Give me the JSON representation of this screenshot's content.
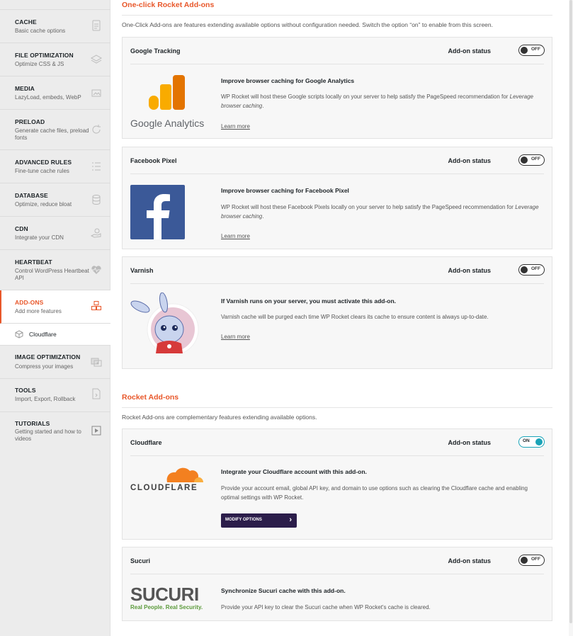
{
  "sidebar": {
    "items": [
      {
        "title": "CACHE",
        "sub": "Basic cache options",
        "icon": "document-icon"
      },
      {
        "title": "FILE OPTIMIZATION",
        "sub": "Optimize CSS & JS",
        "icon": "layers-icon"
      },
      {
        "title": "MEDIA",
        "sub": "LazyLoad, embeds, WebP",
        "icon": "image-icon"
      },
      {
        "title": "PRELOAD",
        "sub": "Generate cache files, preload fonts",
        "icon": "refresh-icon"
      },
      {
        "title": "ADVANCED RULES",
        "sub": "Fine-tune cache rules",
        "icon": "list-icon"
      },
      {
        "title": "DATABASE",
        "sub": "Optimize, reduce bloat",
        "icon": "database-icon"
      },
      {
        "title": "CDN",
        "sub": "Integrate your CDN",
        "icon": "cdn-hand-icon"
      },
      {
        "title": "HEARTBEAT",
        "sub": "Control WordPress Heartbeat API",
        "icon": "heartbeat-icon"
      },
      {
        "title": "ADD-ONS",
        "sub": "Add more features",
        "icon": "cubes-icon"
      },
      {
        "title": "IMAGE OPTIMIZATION",
        "sub": "Compress your images",
        "icon": "image-compress-icon"
      },
      {
        "title": "TOOLS",
        "sub": "Import, Export, Rollback",
        "icon": "tools-doc-icon"
      },
      {
        "title": "TUTORIALS",
        "sub": "Getting started and how to videos",
        "icon": "play-icon"
      }
    ],
    "sub_item": {
      "label": "Cloudflare",
      "icon": "cube-icon"
    }
  },
  "one_click": {
    "title": "One-click Rocket Add-ons",
    "desc": "One-Click Add-ons are features extending available options without configuration needed. Switch the option “on” to enable from this screen.",
    "cards": [
      {
        "name": "Google Tracking",
        "status_label": "Add-on status",
        "toggle": "OFF",
        "logo_text": "Google Analytics",
        "heading": "Improve browser caching for Google Analytics",
        "body": "WP Rocket will host these Google scripts locally on your server to help satisfy the PageSpeed recommendation for",
        "body_em": "Leverage browser caching",
        "link": "Learn more"
      },
      {
        "name": "Facebook Pixel",
        "status_label": "Add-on status",
        "toggle": "OFF",
        "heading": "Improve browser caching for Facebook Pixel",
        "body": "WP Rocket will host these Facebook Pixels locally on your server to help satisfy the PageSpeed recommendation for",
        "body_em": "Leverage browser caching",
        "link": "Learn more"
      },
      {
        "name": "Varnish",
        "status_label": "Add-on status",
        "toggle": "OFF",
        "heading": "If Varnish runs on your server, you must activate this add-on.",
        "body": "Varnish cache will be purged each time WP Rocket clears its cache to ensure content is always up-to-date.",
        "link": "Learn more"
      }
    ]
  },
  "rocket": {
    "title": "Rocket Add-ons",
    "desc": "Rocket Add-ons are complementary features extending available options.",
    "cards": [
      {
        "name": "Cloudflare",
        "status_label": "Add-on status",
        "toggle": "ON",
        "logo_text": "CLOUDFLARE",
        "heading": "Integrate your Cloudflare account with this add-on.",
        "body": "Provide your account email, global API key, and domain to use options such as clearing the Cloudflare cache and enabling optimal settings with WP Rocket.",
        "button": "MODIFY OPTIONS"
      },
      {
        "name": "Sucuri",
        "status_label": "Add-on status",
        "toggle": "OFF",
        "logo_text": "SUCURI",
        "logo_tagline": "Real People. Real Security.",
        "heading": "Synchronize Sucuri cache with this add-on.",
        "body": "Provide your API key to clear the Sucuri cache when WP Rocket's cache is cleared."
      }
    ]
  },
  "colors": {
    "accent": "#e8572a",
    "toggle_on": "#1aa4b8",
    "button": "#2b1d4a"
  }
}
